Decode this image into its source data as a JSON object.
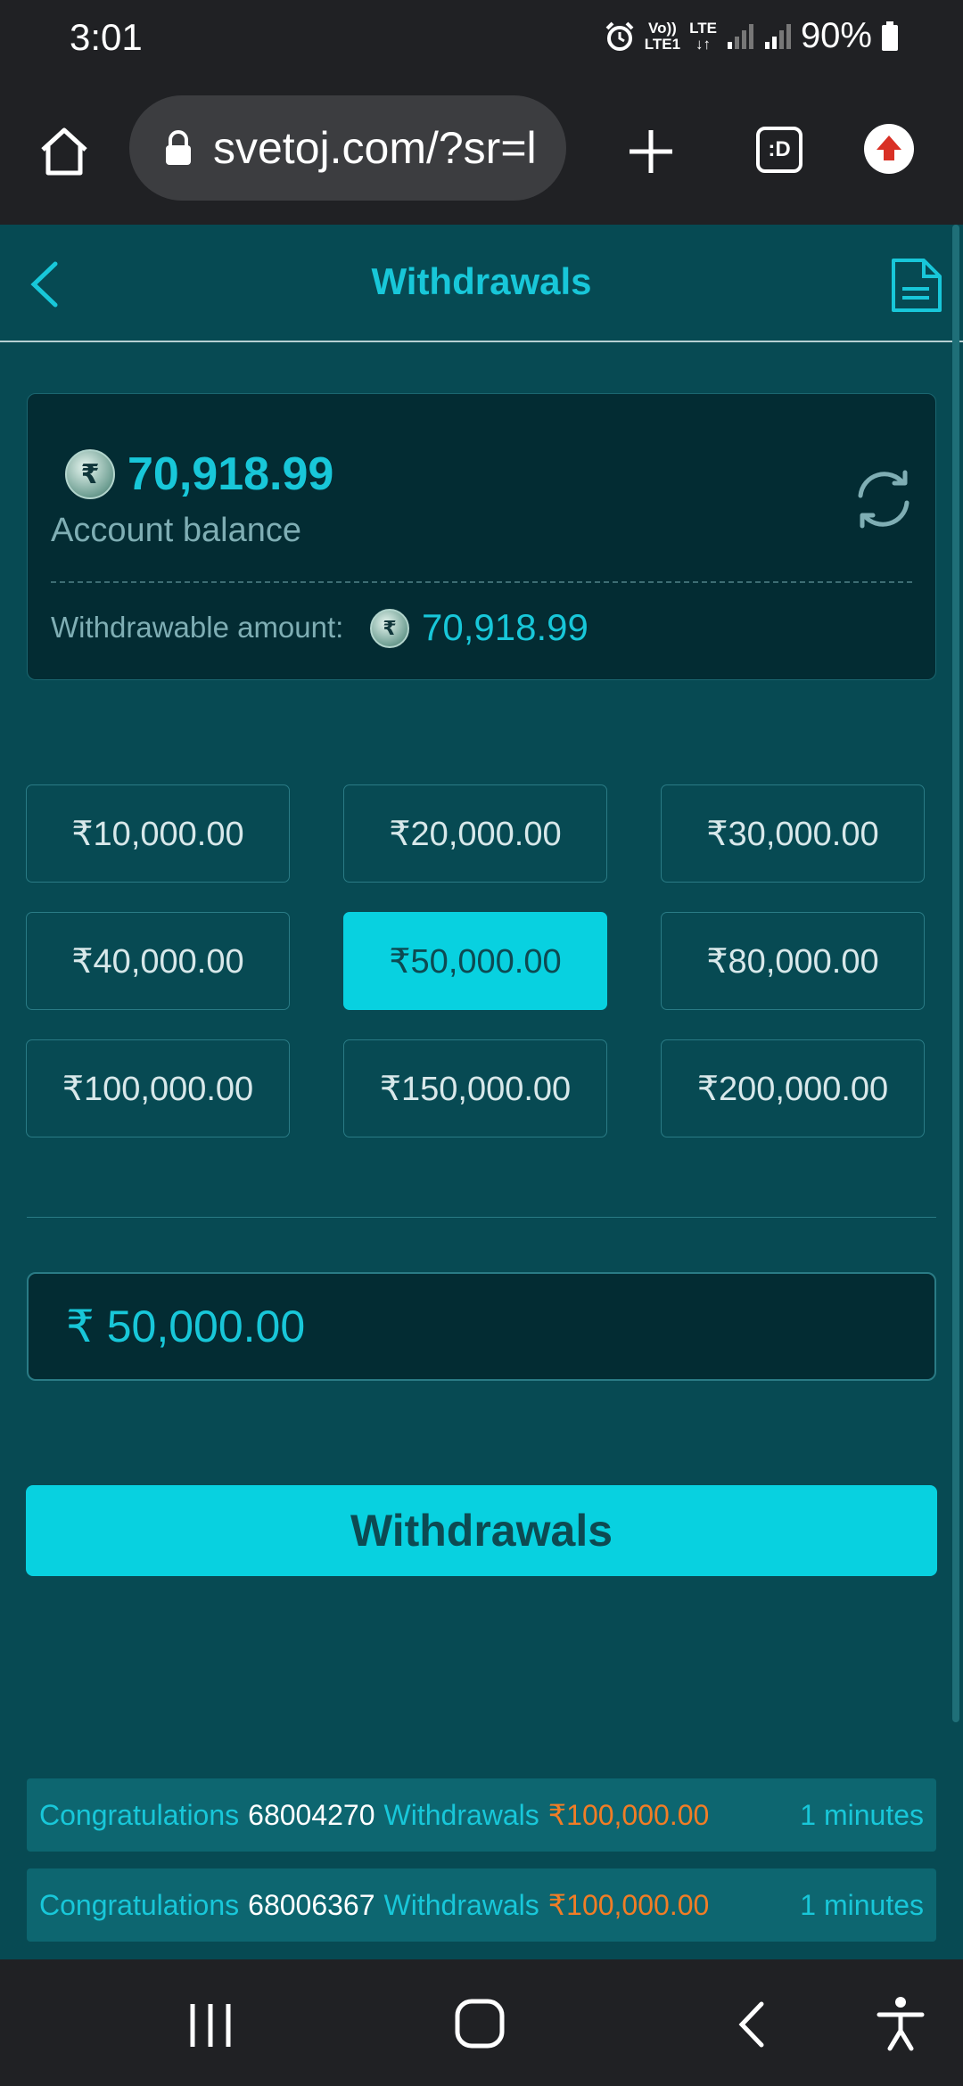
{
  "status_bar": {
    "time": "3:01",
    "volte_top": "Vo))",
    "volte_bottom": "LTE1",
    "lte_top": "LTE",
    "lte_bottom": "↓↑",
    "battery": "90%"
  },
  "browser": {
    "url": "svetoj.com/?sr=l",
    "tab_label": ":D"
  },
  "header": {
    "title": "Withdrawals"
  },
  "balance": {
    "currency_symbol": "₹",
    "amount": "70,918.99",
    "label": "Account balance",
    "withdrawable_label": "Withdrawable amount:",
    "withdrawable_amount": "70,918.99"
  },
  "amount_options": [
    {
      "label": "₹10,000.00",
      "selected": false
    },
    {
      "label": "₹20,000.00",
      "selected": false
    },
    {
      "label": "₹30,000.00",
      "selected": false
    },
    {
      "label": "₹40,000.00",
      "selected": false
    },
    {
      "label": "₹50,000.00",
      "selected": true
    },
    {
      "label": "₹80,000.00",
      "selected": false
    },
    {
      "label": "₹100,000.00",
      "selected": false
    },
    {
      "label": "₹150,000.00",
      "selected": false
    },
    {
      "label": "₹200,000.00",
      "selected": false
    }
  ],
  "amount_input": {
    "value": "₹ 50,000.00"
  },
  "submit": {
    "label": "Withdrawals"
  },
  "ticker": [
    {
      "prefix": "Congratulations",
      "id": "68004270",
      "action": "Withdrawals",
      "amount": "₹100,000.00",
      "time": "1 minutes"
    },
    {
      "prefix": "Congratulations",
      "id": "68006367",
      "action": "Withdrawals",
      "amount": "₹100,000.00",
      "time": "1 minutes"
    }
  ],
  "colors": {
    "accent": "#08d1e0",
    "background": "#074a53",
    "card": "#032c33",
    "highlight_amount": "#f07d26"
  }
}
